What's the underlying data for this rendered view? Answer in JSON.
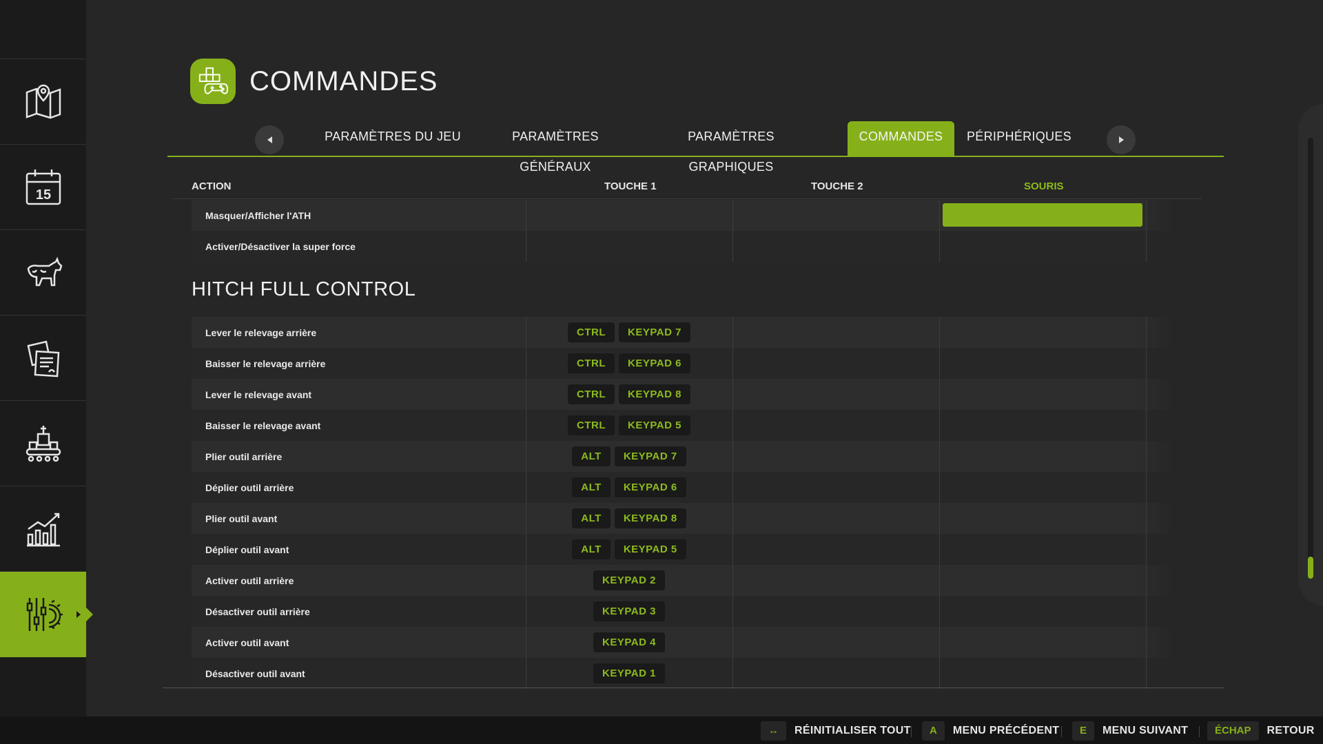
{
  "page": {
    "title": "COMMANDES"
  },
  "tabs": {
    "items": [
      "PARAMÈTRES DU JEU",
      "PARAMÈTRES GÉNÉRAUX",
      "PARAMÈTRES GRAPHIQUES",
      "COMMANDES",
      "PÉRIPHÉRIQUES"
    ],
    "active": "COMMANDES"
  },
  "sidebar": {
    "items": [
      "map-icon",
      "calendar-icon",
      "animals-icon",
      "contracts-icon",
      "production-icon",
      "statistics-icon",
      "settings-icon"
    ],
    "calendar_number": "15",
    "active": "settings-icon"
  },
  "table": {
    "headers": {
      "action": "ACTION",
      "key1": "TOUCHE 1",
      "key2": "TOUCHE 2",
      "mouse": "SOURIS"
    },
    "top_rows": [
      {
        "label": "Masquer/Afficher l'ATH"
      },
      {
        "label": "Activer/Désactiver la super force"
      }
    ],
    "section_title": "HITCH FULL CONTROL",
    "rows": [
      {
        "label": "Lever le relevage arrière",
        "mod": "CTRL",
        "key": "KEYPAD 7"
      },
      {
        "label": "Baisser le relevage arrière",
        "mod": "CTRL",
        "key": "KEYPAD 6"
      },
      {
        "label": "Lever le relevage avant",
        "mod": "CTRL",
        "key": "KEYPAD 8"
      },
      {
        "label": "Baisser le relevage avant",
        "mod": "CTRL",
        "key": "KEYPAD 5"
      },
      {
        "label": "Plier outil arrière",
        "mod": "ALT",
        "key": "KEYPAD 7"
      },
      {
        "label": "Déplier outil arrière",
        "mod": "ALT",
        "key": "KEYPAD 6"
      },
      {
        "label": "Plier outil avant",
        "mod": "ALT",
        "key": "KEYPAD 8"
      },
      {
        "label": "Déplier outil avant",
        "mod": "ALT",
        "key": "KEYPAD 5"
      },
      {
        "label": "Activer outil arrière",
        "mod": "",
        "key": "KEYPAD 2"
      },
      {
        "label": "Désactiver outil arrière",
        "mod": "",
        "key": "KEYPAD 3"
      },
      {
        "label": "Activer outil avant",
        "mod": "",
        "key": "KEYPAD 4"
      },
      {
        "label": "Désactiver outil avant",
        "mod": "",
        "key": "KEYPAD 1"
      }
    ]
  },
  "footer": {
    "reset": {
      "key": "↔",
      "label": "RÉINITIALISER TOUT"
    },
    "prev": {
      "key": "A",
      "label": "MENU PRÉCÉDENT"
    },
    "next": {
      "key": "E",
      "label": "MENU SUIVANT"
    },
    "back": {
      "key": "ÉCHAP",
      "label": "RETOUR"
    }
  },
  "colors": {
    "accent": "#86b01a",
    "background": "#262626",
    "sidebar": "#1b1b1b"
  }
}
